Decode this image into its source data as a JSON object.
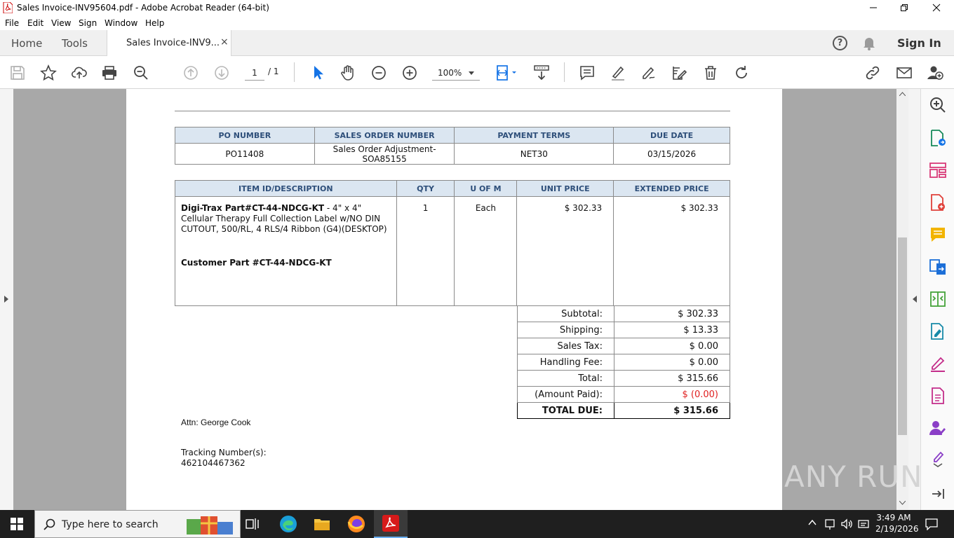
{
  "window": {
    "title": "Sales Invoice-INV95604.pdf - Adobe Acrobat Reader (64-bit)"
  },
  "menu": [
    "File",
    "Edit",
    "View",
    "Sign",
    "Window",
    "Help"
  ],
  "tabs": {
    "home": "Home",
    "tools": "Tools",
    "doc": "Sales Invoice-INV9...",
    "close": "×",
    "signin": "Sign In",
    "help": "?"
  },
  "toolbar": {
    "page_current": "1",
    "page_total": "/ 1",
    "zoom": "100%"
  },
  "invoice": {
    "header_cols": [
      "PO NUMBER",
      "SALES ORDER NUMBER",
      "PAYMENT TERMS",
      "DUE DATE"
    ],
    "header_vals": [
      "PO11408",
      "Sales Order Adjustment-\nSOA85155",
      "NET30",
      "03/15/2026"
    ],
    "item_cols": [
      "ITEM ID/DESCRIPTION",
      "QTY",
      "U OF M",
      "UNIT PRICE",
      "EXTENDED PRICE"
    ],
    "item": {
      "part_bold": "Digi-Trax Part#CT-44-NDCG-KT",
      "desc": " - 4\" x 4\" Cellular Therapy Full Collection Label w/NO DIN CUTOUT, 500/RL, 4 RLS/4 Ribbon (G4)(DESKTOP)",
      "customer_part": "Customer Part #CT-44-NDCG-KT",
      "qty": "1",
      "uom": "Each",
      "unit_price": "$ 302.33",
      "extended": "$ 302.33"
    },
    "totals": [
      {
        "label": "Subtotal:",
        "value": "$ 302.33"
      },
      {
        "label": "Shipping:",
        "value": "$ 13.33"
      },
      {
        "label": "Sales Tax:",
        "value": "$ 0.00"
      },
      {
        "label": "Handling Fee:",
        "value": "$ 0.00"
      },
      {
        "label": "Total:",
        "value": "$ 315.66"
      },
      {
        "label": "(Amount Paid):",
        "value": "$ (0.00)"
      }
    ],
    "total_due": {
      "label": "TOTAL DUE:",
      "value": "$ 315.66"
    },
    "attn": "Attn: George Cook",
    "tracking_label": "Tracking Number(s):",
    "tracking_number": "462104467362"
  },
  "taskbar": {
    "search_placeholder": "Type here to search",
    "time": "3:49 AM",
    "date": "2/19/2026"
  },
  "watermark": "ANY RUN",
  "colors": {
    "accent": "#1473e6",
    "table_header_bg": "#dbe6f1",
    "table_header_text": "#2e4f7a",
    "paid_red": "#e02020",
    "taskbar": "#1f1f1f"
  }
}
